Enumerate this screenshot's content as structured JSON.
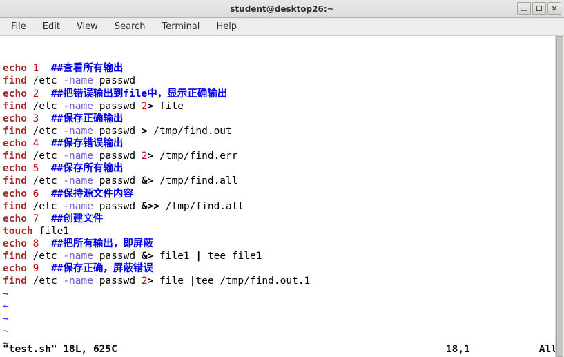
{
  "window": {
    "title": "student@desktop26:~"
  },
  "menu": {
    "file": "File",
    "edit": "Edit",
    "view": "View",
    "search": "Search",
    "terminal": "Terminal",
    "help": "Help"
  },
  "lines": [
    {
      "parts": [
        {
          "c": "cmd",
          "t": "echo"
        },
        {
          "c": "arg",
          "t": " "
        },
        {
          "c": "num",
          "t": "1"
        },
        {
          "c": "arg",
          "t": "  "
        },
        {
          "c": "comment",
          "t": "##查看所有输出"
        }
      ]
    },
    {
      "parts": [
        {
          "c": "cmd",
          "t": "find"
        },
        {
          "c": "arg",
          "t": " /etc "
        },
        {
          "c": "opt",
          "t": "-name"
        },
        {
          "c": "arg",
          "t": " passwd"
        }
      ]
    },
    {
      "parts": [
        {
          "c": "cmd",
          "t": "echo"
        },
        {
          "c": "arg",
          "t": " "
        },
        {
          "c": "num",
          "t": "2"
        },
        {
          "c": "arg",
          "t": "  "
        },
        {
          "c": "comment",
          "t": "##把错误输出到file中，显示正确输出"
        }
      ]
    },
    {
      "parts": [
        {
          "c": "cmd",
          "t": "find"
        },
        {
          "c": "arg",
          "t": " /etc "
        },
        {
          "c": "opt",
          "t": "-name"
        },
        {
          "c": "arg",
          "t": " passwd "
        },
        {
          "c": "redirnum",
          "t": "2"
        },
        {
          "c": "redir",
          "t": ">"
        },
        {
          "c": "arg",
          "t": " file"
        }
      ]
    },
    {
      "parts": [
        {
          "c": "cmd",
          "t": "echo"
        },
        {
          "c": "arg",
          "t": " "
        },
        {
          "c": "num",
          "t": "3"
        },
        {
          "c": "arg",
          "t": "  "
        },
        {
          "c": "comment",
          "t": "##保存正确输出"
        }
      ]
    },
    {
      "parts": [
        {
          "c": "cmd",
          "t": "find"
        },
        {
          "c": "arg",
          "t": " /etc "
        },
        {
          "c": "opt",
          "t": "-name"
        },
        {
          "c": "arg",
          "t": " passwd "
        },
        {
          "c": "redir",
          "t": ">"
        },
        {
          "c": "arg",
          "t": " /tmp/find.out"
        }
      ]
    },
    {
      "parts": [
        {
          "c": "cmd",
          "t": "echo"
        },
        {
          "c": "arg",
          "t": " "
        },
        {
          "c": "num",
          "t": "4"
        },
        {
          "c": "arg",
          "t": "  "
        },
        {
          "c": "comment",
          "t": "##保存错误输出"
        }
      ]
    },
    {
      "parts": [
        {
          "c": "cmd",
          "t": "find"
        },
        {
          "c": "arg",
          "t": " /etc "
        },
        {
          "c": "opt",
          "t": "-name"
        },
        {
          "c": "arg",
          "t": " passwd "
        },
        {
          "c": "redirnum",
          "t": "2"
        },
        {
          "c": "redir",
          "t": ">"
        },
        {
          "c": "arg",
          "t": " /tmp/find.err"
        }
      ]
    },
    {
      "parts": [
        {
          "c": "cmd",
          "t": "echo"
        },
        {
          "c": "arg",
          "t": " "
        },
        {
          "c": "num",
          "t": "5"
        },
        {
          "c": "arg",
          "t": "  "
        },
        {
          "c": "comment",
          "t": "##保存所有输出"
        }
      ]
    },
    {
      "parts": [
        {
          "c": "cmd",
          "t": "find"
        },
        {
          "c": "arg",
          "t": " /etc "
        },
        {
          "c": "opt",
          "t": "-name"
        },
        {
          "c": "arg",
          "t": " passwd "
        },
        {
          "c": "redir",
          "t": "&>"
        },
        {
          "c": "arg",
          "t": " /tmp/find.all"
        }
      ]
    },
    {
      "parts": [
        {
          "c": "cmd",
          "t": "echo"
        },
        {
          "c": "arg",
          "t": " "
        },
        {
          "c": "num",
          "t": "6"
        },
        {
          "c": "arg",
          "t": "  "
        },
        {
          "c": "comment",
          "t": "##保持源文件内容"
        }
      ]
    },
    {
      "parts": [
        {
          "c": "cmd",
          "t": "find"
        },
        {
          "c": "arg",
          "t": " /etc "
        },
        {
          "c": "opt",
          "t": "-name"
        },
        {
          "c": "arg",
          "t": " passwd "
        },
        {
          "c": "redir",
          "t": "&>>"
        },
        {
          "c": "arg",
          "t": " /tmp/find.all"
        }
      ]
    },
    {
      "parts": [
        {
          "c": "cmd",
          "t": "echo"
        },
        {
          "c": "arg",
          "t": " "
        },
        {
          "c": "num",
          "t": "7"
        },
        {
          "c": "arg",
          "t": "  "
        },
        {
          "c": "comment",
          "t": "##创建文件"
        }
      ]
    },
    {
      "parts": [
        {
          "c": "cmd",
          "t": "touch"
        },
        {
          "c": "arg",
          "t": " file1"
        }
      ]
    },
    {
      "parts": [
        {
          "c": "cmd",
          "t": "echo"
        },
        {
          "c": "arg",
          "t": " "
        },
        {
          "c": "num",
          "t": "8"
        },
        {
          "c": "arg",
          "t": "  "
        },
        {
          "c": "comment",
          "t": "##把所有输出，即屏蔽"
        }
      ]
    },
    {
      "parts": [
        {
          "c": "cmd",
          "t": "find"
        },
        {
          "c": "arg",
          "t": " /etc "
        },
        {
          "c": "opt",
          "t": "-name"
        },
        {
          "c": "arg",
          "t": " passwd "
        },
        {
          "c": "redir",
          "t": "&>"
        },
        {
          "c": "arg",
          "t": " file1 "
        },
        {
          "c": "pipe",
          "t": "|"
        },
        {
          "c": "arg",
          "t": " tee file1"
        }
      ]
    },
    {
      "parts": [
        {
          "c": "cmd",
          "t": "echo"
        },
        {
          "c": "arg",
          "t": " "
        },
        {
          "c": "num",
          "t": "9"
        },
        {
          "c": "arg",
          "t": "  "
        },
        {
          "c": "comment",
          "t": "##保存正确，屏蔽错误"
        }
      ]
    },
    {
      "parts": [
        {
          "c": "cmd",
          "t": "find"
        },
        {
          "c": "arg",
          "t": " /etc "
        },
        {
          "c": "opt",
          "t": "-name"
        },
        {
          "c": "arg",
          "t": " passwd "
        },
        {
          "c": "redirnum",
          "t": "2"
        },
        {
          "c": "redir",
          "t": ">"
        },
        {
          "c": "arg",
          "t": " file "
        },
        {
          "c": "pipe",
          "t": "|"
        },
        {
          "c": "arg",
          "t": "tee /tmp/find.out.1"
        }
      ]
    }
  ],
  "tildes": [
    "~",
    "~",
    "~",
    "~",
    "~"
  ],
  "status": {
    "left": "\"test.sh\" 18L, 625C",
    "position": "18,1",
    "percent": "All"
  }
}
